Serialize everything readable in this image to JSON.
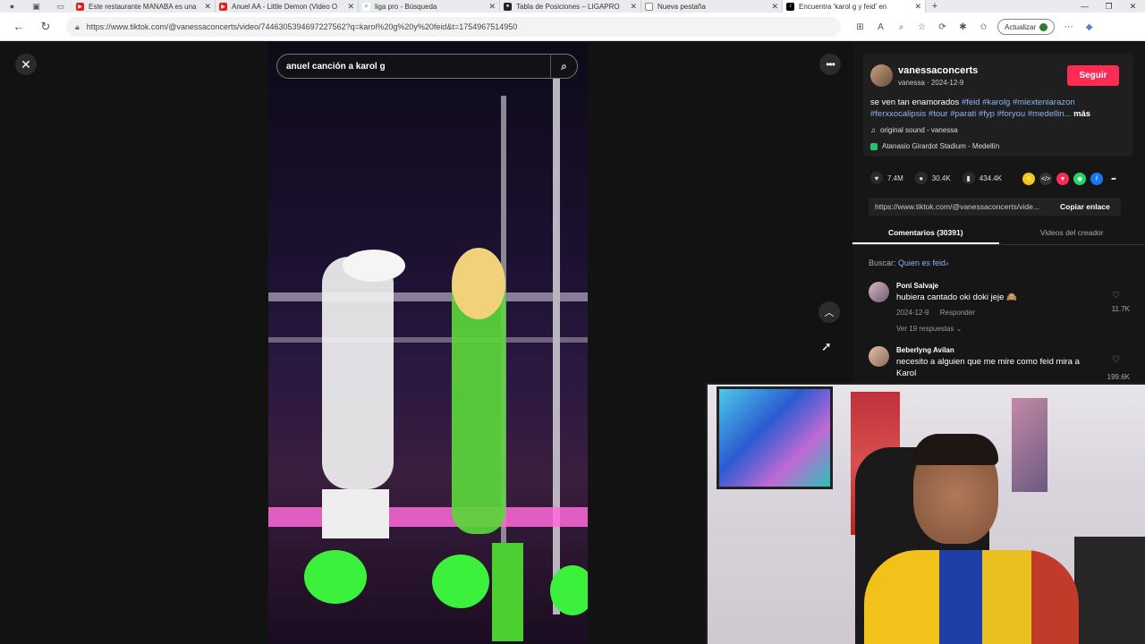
{
  "browser": {
    "tabs": [
      {
        "title": "Este restaurante MANABA es una",
        "favicon_color": "#e62117",
        "active": false
      },
      {
        "title": "Anuel AA - Little Demon (Video O",
        "favicon_color": "#e62117",
        "active": false
      },
      {
        "title": "liga pro - Búsqueda",
        "favicon_color": "#1a73e8",
        "active": false
      },
      {
        "title": "Tabla de Posiciones – LIGAPRO",
        "favicon_color": "#222222",
        "active": false
      },
      {
        "title": "Nueva pestaña",
        "favicon_color": "#6b6b6b",
        "active": false
      },
      {
        "title": "Encuentra 'karol g y feid' en",
        "favicon_color": "#000000",
        "active": true
      }
    ],
    "url": "https://www.tiktok.com/@vanessaconcerts/video/7446305394697227562?q=karol%20g%20y%20feid&t=1754967514950",
    "update_label": "Actualizar"
  },
  "video": {
    "search_query": "anuel canción a karol g"
  },
  "creator": {
    "username": "vanessaconcerts",
    "subtitle": "vanessa · 2024-12-9",
    "follow_label": "Seguir",
    "description_text": "se ven tan enamorados ",
    "tags_line1": "#feid #karolg #miexteniarazon",
    "tags_line2": "#ferxxocalipsis #tour #parati #fyp #foryou #medellin...",
    "more_label": "más",
    "sound": "original sound - vanessa",
    "location": "Atanasio Girardot Stadium - Medellín"
  },
  "stats": {
    "likes": "7.4M",
    "comments": "30.4K",
    "saves": "434.4K"
  },
  "link": {
    "url": "https://www.tiktok.com/@vanessaconcerts/vide...",
    "copy_label": "Copiar enlace"
  },
  "panel_tabs": {
    "comments": "Comentarios (30391)",
    "creator_videos": "Videos del creador"
  },
  "comments_search": {
    "label": "Buscar:",
    "query": "Quien es feid"
  },
  "comments": [
    {
      "user": "Poni Salvaje",
      "text": "hubiera cantado oki doki jeje 🙈",
      "date": "2024-12-9",
      "reply": "Responder",
      "more": "Ver 19 respuestas ⌄",
      "likes": "11.7K"
    },
    {
      "user": "Beberlyng Avilan",
      "text": "necesito a alguien que me mire como feid mira a Karol",
      "date": "",
      "reply": "",
      "more": "",
      "likes": "199.6K"
    }
  ],
  "colors": {
    "accent": "#fe2c55",
    "link": "#8ab4f8",
    "panel_bg": "#161616"
  }
}
